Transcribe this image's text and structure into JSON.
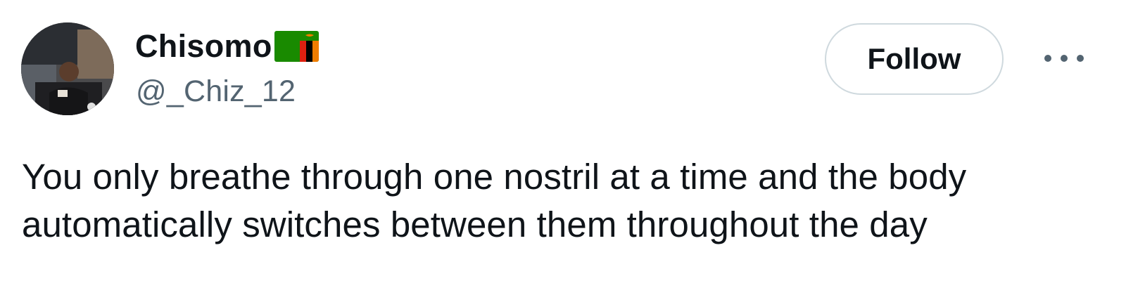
{
  "author": {
    "display_name": "Chisomo",
    "handle": "@_Chiz_12",
    "flag_icon": "zambia-flag-icon",
    "avatar_icon": "profile-photo"
  },
  "actions": {
    "follow_label": "Follow",
    "more_icon": "more-options-icon"
  },
  "tweet": {
    "lines": [
      "You only breathe through one nostril at a time and the body",
      "automatically switches between them throughout the day"
    ]
  },
  "colors": {
    "text": "#0f1419",
    "secondary": "#536471",
    "border": "#cfd9de",
    "flag_green": "#198a00",
    "flag_red": "#de2010",
    "flag_black": "#000000",
    "flag_orange": "#ef7d00"
  }
}
